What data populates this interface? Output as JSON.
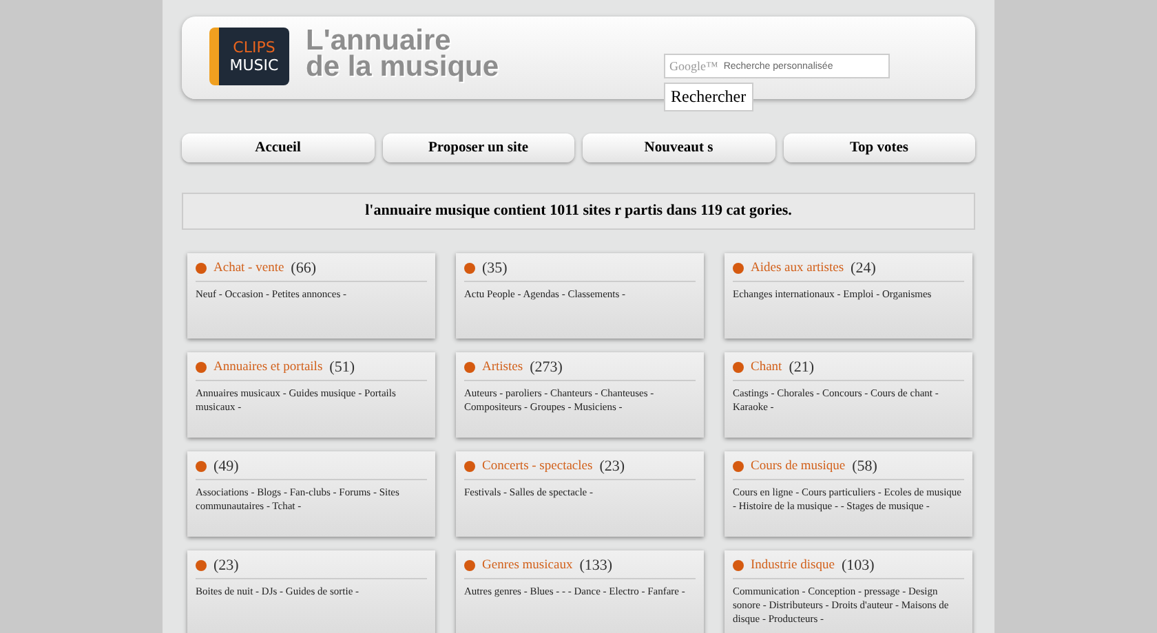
{
  "header": {
    "logo_top": "CLIPS",
    "logo_bottom": "MUSIC",
    "title_line1": "L'annuaire",
    "title_line2": "de la musique",
    "search": {
      "brand": "Google™",
      "placeholder": "Recherche personnalisée",
      "button": "Rechercher"
    }
  },
  "nav": [
    "Accueil",
    "Proposer un site",
    "Nouveaut s",
    "Top votes"
  ],
  "info": "l'annuaire musique contient 1011 sites r partis dans 119 cat gories.",
  "categories": [
    {
      "title": "Achat - vente",
      "count": "(66)",
      "links": "Neuf - Occasion - Petites annonces -"
    },
    {
      "count": "(35)",
      "links": "Actu People - Agendas - Classements -"
    },
    {
      "title": "Aides aux artistes",
      "count": "(24)",
      "links": "Echanges internationaux - Emploi - Organismes"
    },
    {
      "title": "Annuaires et portails",
      "count": "(51)",
      "links": "Annuaires musicaux - Guides musique - Portails musicaux -"
    },
    {
      "title": "Artistes",
      "count": "(273)",
      "links": "Auteurs - paroliers - Chanteurs - Chanteuses - Compositeurs - Groupes - Musiciens -"
    },
    {
      "title": "Chant",
      "count": "(21)",
      "links": "Castings - Chorales - Concours - Cours de chant - Karaoke -"
    },
    {
      "count": "(49)",
      "links": "Associations - Blogs - Fan-clubs - Forums - Sites communautaires - Tchat -"
    },
    {
      "title": "Concerts - spectacles",
      "count": "(23)",
      "links": "Festivals - Salles de spectacle -"
    },
    {
      "title": "Cours de musique",
      "count": "(58)",
      "links": "Cours en ligne - Cours particuliers - Ecoles de musique - Histoire de la musique - - Stages de musique -"
    },
    {
      "count": "(23)",
      "links": "Boites de nuit - DJs - Guides de sortie -"
    },
    {
      "title": "Genres musicaux",
      "count": "(133)",
      "links": "Autres genres - Blues - - - Dance - Electro - Fanfare -"
    },
    {
      "title": "Industrie disque",
      "count": "(103)",
      "links": "Communication - Conception - pressage - Design sonore - Distributeurs - Droits d'auteur - Maisons de disque - Producteurs -"
    }
  ]
}
